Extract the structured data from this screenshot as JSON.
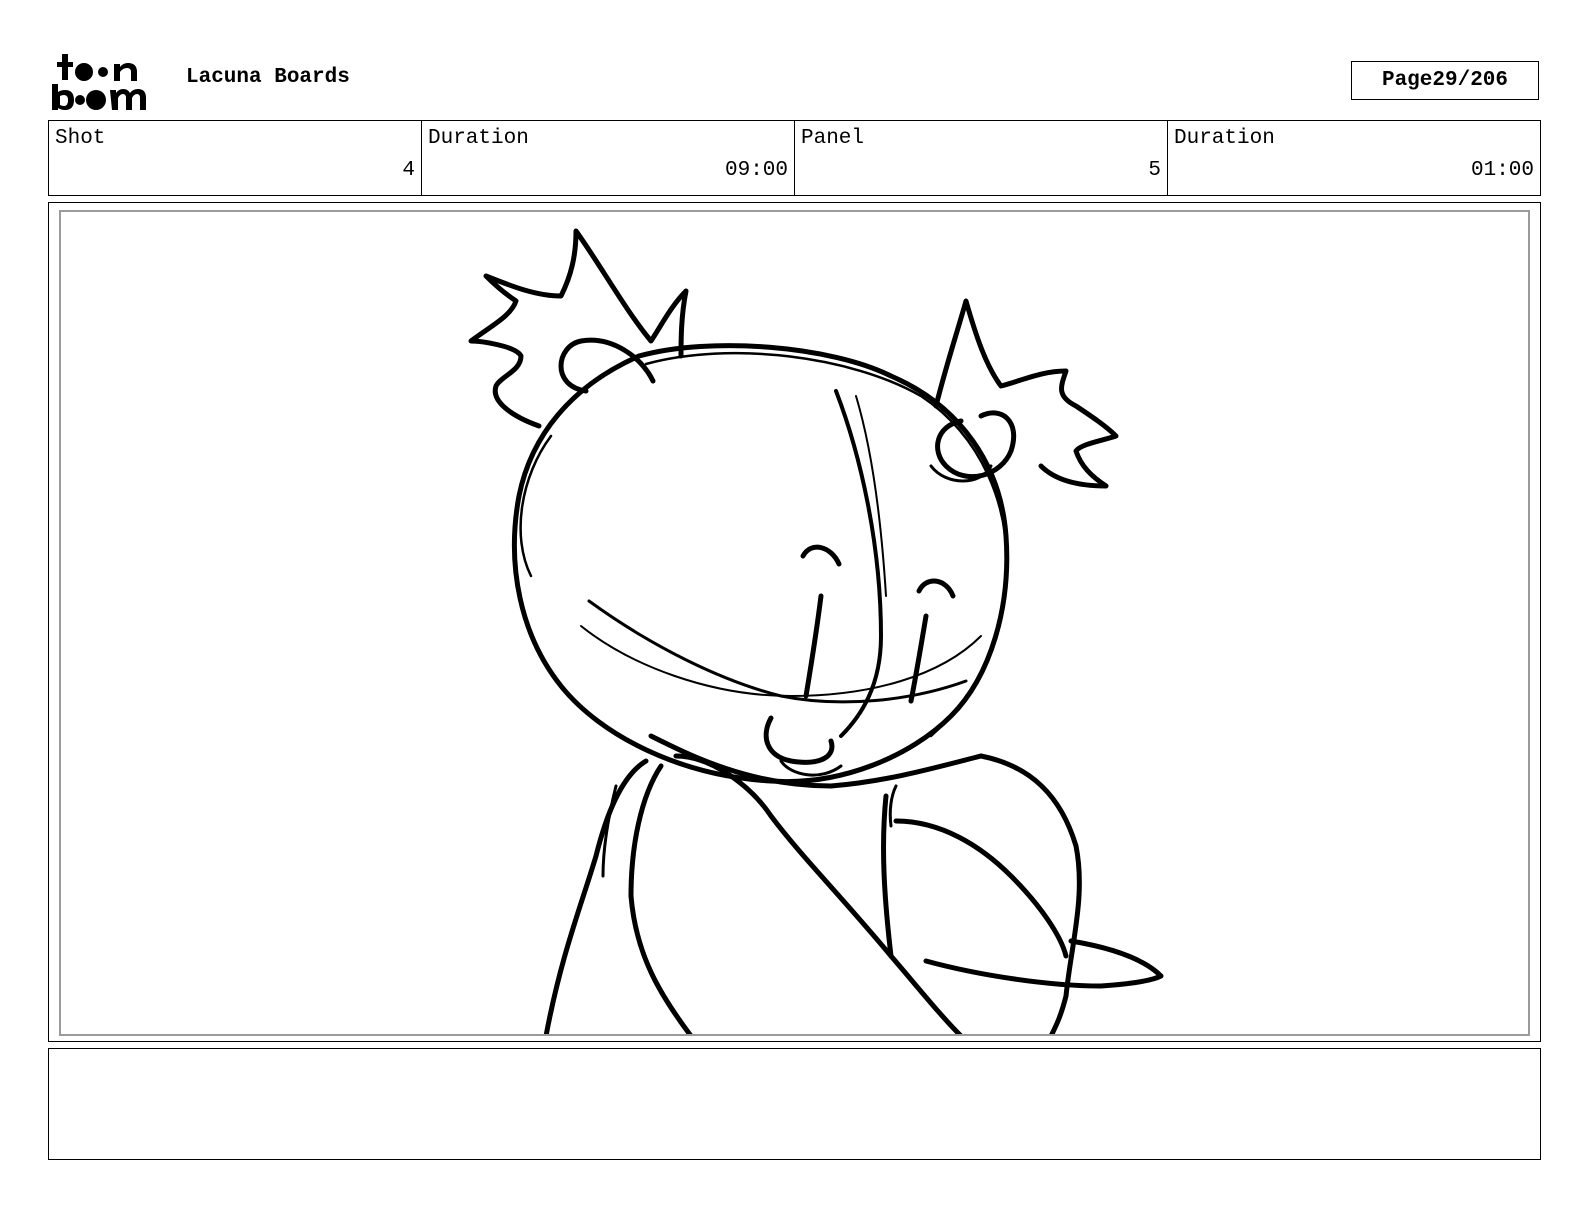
{
  "header": {
    "logo_text": "toon boom",
    "project_title": "Lacuna Boards",
    "page_label": "Page",
    "page_number": "29/206"
  },
  "info": {
    "shot_label": "Shot",
    "shot_value": "4",
    "shot_duration_label": "Duration",
    "shot_duration_value": "09:00",
    "panel_label": "Panel",
    "panel_value": "5",
    "panel_duration_label": "Duration",
    "panel_duration_value": "01:00"
  },
  "panel": {
    "drawing": "rough-character-sketch"
  },
  "notes": {
    "text": ""
  }
}
